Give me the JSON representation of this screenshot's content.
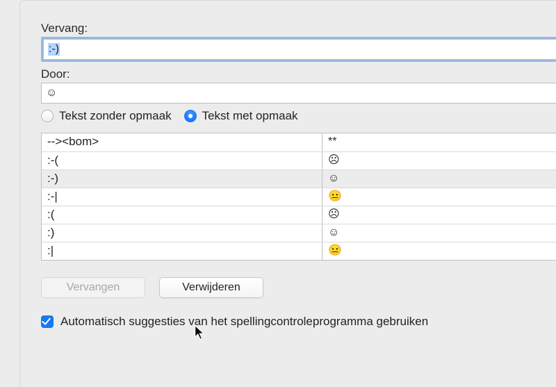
{
  "labels": {
    "replace": "Vervang:",
    "with": "Door:"
  },
  "inputs": {
    "replace_value": ":-)",
    "with_value": "☺"
  },
  "radios": {
    "plain": "Tekst zonder opmaak",
    "formatted": "Tekst met opmaak",
    "selected": "formatted"
  },
  "table": {
    "rows": [
      {
        "from": "--><bom>",
        "to": "**",
        "selected": false
      },
      {
        "from": ":-(",
        "to": "☹",
        "selected": false
      },
      {
        "from": ":-)",
        "to": "☺",
        "selected": true
      },
      {
        "from": ":-|",
        "to": "😐",
        "selected": false
      },
      {
        "from": ":(",
        "to": "☹",
        "selected": false
      },
      {
        "from": ":)",
        "to": "☺",
        "selected": false
      },
      {
        "from": ":|",
        "to": "😐",
        "selected": false
      }
    ]
  },
  "buttons": {
    "replace": "Vervangen",
    "delete": "Verwijderen"
  },
  "checkbox": {
    "auto_suggest": "Automatisch suggesties van het spellingcontroleprogramma gebruiken",
    "checked": true
  }
}
